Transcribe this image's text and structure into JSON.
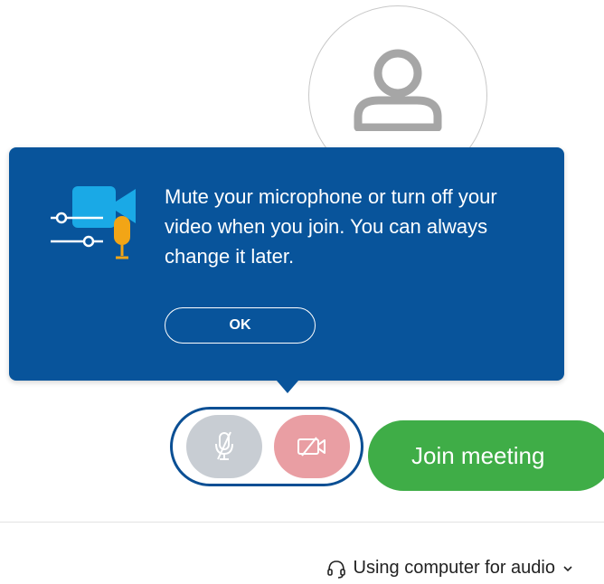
{
  "tooltip": {
    "message": "Mute your microphone or turn off your video when you join. You can always change it later.",
    "ok_label": "OK"
  },
  "controls": {
    "join_label": "Join meeting"
  },
  "audio": {
    "label": "Using computer for audio"
  },
  "colors": {
    "tooltip_bg": "#08549b",
    "join_green": "#3fad47",
    "mic_gray": "#c8cdd3",
    "video_red": "#e99ea3"
  },
  "icons": {
    "avatar": "person-icon",
    "mic": "mic-muted-icon",
    "video": "video-off-icon",
    "headset": "headset-icon",
    "chevron": "chevron-down-icon"
  }
}
